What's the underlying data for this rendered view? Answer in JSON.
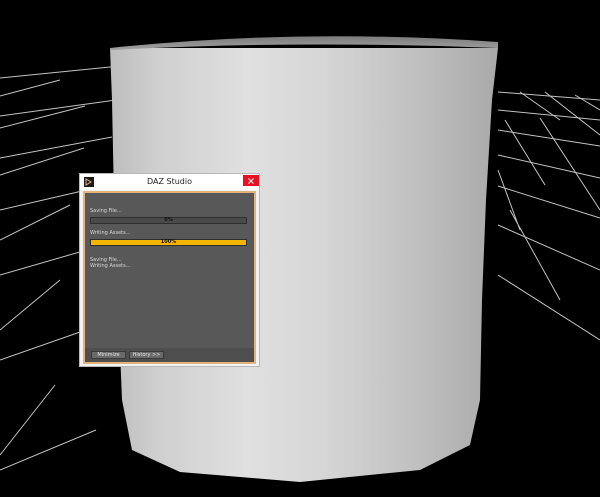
{
  "dialog": {
    "title": "DAZ Studio",
    "app_icon": "daz-studio-icon",
    "close_icon": "close-icon",
    "section1": {
      "label": "Saving File...",
      "progress": 0,
      "progress_label": "0%"
    },
    "section2": {
      "label": "Writing Assets...",
      "progress": 1.0,
      "progress_label": "100%"
    },
    "log": [
      "Saving File...",
      "Writing Assets..."
    ],
    "buttons": {
      "minimize": "Minimize",
      "history": "History >>"
    },
    "colors": {
      "accent": "#f5b400",
      "frame": "#e2b47b",
      "close": "#e81123",
      "panel": "#585858"
    }
  }
}
